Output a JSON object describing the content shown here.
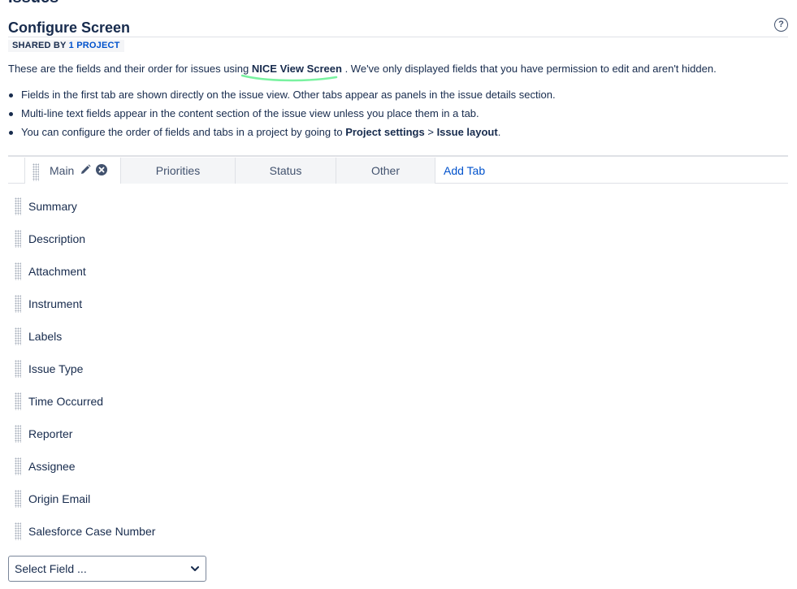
{
  "header": {
    "section_title_cut": "Issues",
    "title": "Configure Screen",
    "help_icon": "question-circle-icon"
  },
  "shared": {
    "label": "SHARED BY",
    "link": "1 PROJECT"
  },
  "intro": {
    "prefix": "These are the fields and their order for issues using",
    "screen_name": "NICE View Screen",
    "suffix": ". We've only displayed fields that you have permission to edit and aren't hidden."
  },
  "bullets": {
    "b1": "Fields in the first tab are shown directly on the issue view. Other tabs appear as panels in the issue details section.",
    "b2": "Multi-line text fields appear in the content section of the issue view unless you place them in a tab.",
    "b3_prefix": "You can configure the order of fields and tabs in a project by going to",
    "b3_link1": "Project settings",
    "b3_sep": ">",
    "b3_link2": "Issue layout",
    "b3_suffix": "."
  },
  "tabs": {
    "main": "Main",
    "priorities": "Priorities",
    "status": "Status",
    "other": "Other",
    "add": "Add Tab"
  },
  "fields": [
    "Summary",
    "Description",
    "Attachment",
    "Instrument",
    "Labels",
    "Issue Type",
    "Time Occurred",
    "Reporter",
    "Assignee",
    "Origin Email",
    "Salesforce Case Number"
  ],
  "select": {
    "placeholder": "Select Field ..."
  },
  "colors": {
    "text": "#172b4d",
    "link": "#0052cc",
    "highlight_stroke": "#79f2a0",
    "tab_bg": "#f4f5f7"
  }
}
